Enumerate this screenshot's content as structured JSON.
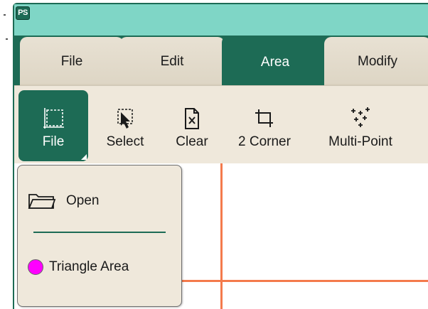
{
  "app": {
    "logo_text": "PS"
  },
  "tabs": [
    {
      "label": "File",
      "active": false
    },
    {
      "label": "Edit",
      "active": false
    },
    {
      "label": "Area",
      "active": true
    },
    {
      "label": "Modify",
      "active": false
    }
  ],
  "ribbon": {
    "buttons": [
      {
        "label": "File",
        "icon": "area-frame-icon",
        "active": true
      },
      {
        "label": "Select",
        "icon": "select-pointer-icon",
        "active": false
      },
      {
        "label": "Clear",
        "icon": "clear-document-icon",
        "active": false
      },
      {
        "label": "2 Corner",
        "icon": "two-corner-crop-icon",
        "active": false
      },
      {
        "label": "Multi-Point",
        "icon": "multi-point-icon",
        "active": false
      }
    ]
  },
  "dropdown": {
    "items": [
      {
        "label": "Open",
        "icon": "folder-icon"
      },
      {
        "label": "Triangle Area",
        "icon": "magenta-circle-icon"
      }
    ]
  },
  "colors": {
    "accent": "#1d6b55",
    "titlebar": "#7fd6c6",
    "surface": "#efe8db",
    "gridline": "#f47a4c",
    "marker": "#ff00ff"
  }
}
